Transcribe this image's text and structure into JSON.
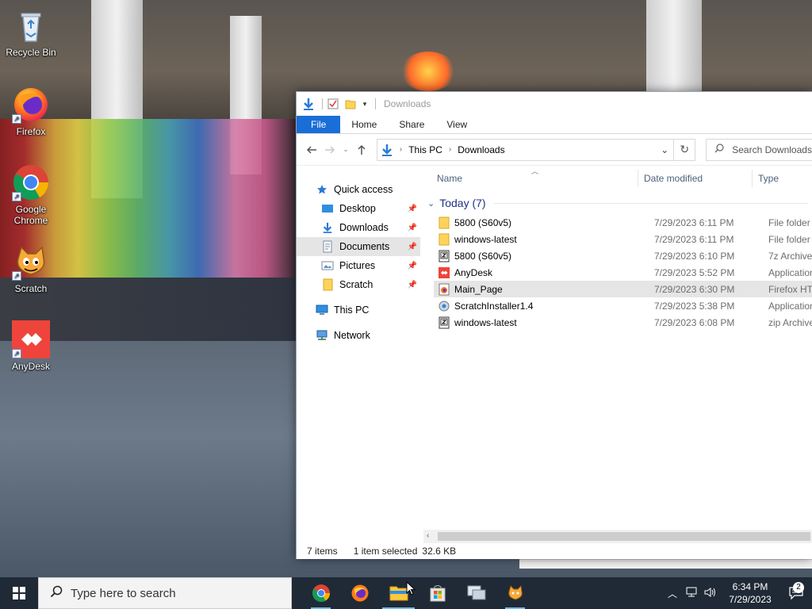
{
  "desktop": {
    "icons": [
      {
        "label": "Recycle Bin"
      },
      {
        "label": "Firefox"
      },
      {
        "label": "Google Chrome"
      },
      {
        "label": "Scratch"
      },
      {
        "label": "AnyDesk"
      }
    ]
  },
  "explorer": {
    "title": "Downloads",
    "ribbon_tabs": [
      "File",
      "Home",
      "Share",
      "View"
    ],
    "breadcrumb": [
      "This PC",
      "Downloads"
    ],
    "search_placeholder": "Search Downloads",
    "nav": {
      "quick_access": "Quick access",
      "items": [
        "Desktop",
        "Downloads",
        "Documents",
        "Pictures",
        "Scratch"
      ],
      "this_pc": "This PC",
      "network": "Network"
    },
    "columns": {
      "name": "Name",
      "date": "Date modified",
      "type": "Type"
    },
    "group": "Today (7)",
    "files": [
      {
        "name": "5800 (S60v5)",
        "date": "7/29/2023 6:11 PM",
        "type": "File folder",
        "icon": "folder-icon"
      },
      {
        "name": "windows-latest",
        "date": "7/29/2023 6:11 PM",
        "type": "File folder",
        "icon": "folder-icon"
      },
      {
        "name": "5800 (S60v5)",
        "date": "7/29/2023 6:10 PM",
        "type": "7z Archive",
        "icon": "archive-icon"
      },
      {
        "name": "AnyDesk",
        "date": "7/29/2023 5:52 PM",
        "type": "Application",
        "icon": "anydesk-icon"
      },
      {
        "name": "Main_Page",
        "date": "7/29/2023 6:30 PM",
        "type": "Firefox HTML",
        "icon": "firefox-html-icon"
      },
      {
        "name": "ScratchInstaller1.4",
        "date": "7/29/2023 5:38 PM",
        "type": "Application",
        "icon": "installer-icon"
      },
      {
        "name": "windows-latest",
        "date": "7/29/2023 6:08 PM",
        "type": "zip Archive",
        "icon": "archive-icon"
      }
    ],
    "status": {
      "count": "7 items",
      "selected": "1 item selected",
      "size": "32.6 KB"
    }
  },
  "taskbar": {
    "search_placeholder": "Type here to search",
    "time": "6:34 PM",
    "date": "7/29/2023",
    "notification_count": "2"
  },
  "colors": {
    "file_tab": "#1a6ed8",
    "taskbar": "#1f2a36",
    "group_header": "#1e3287",
    "selection": "#e5e5e5"
  }
}
